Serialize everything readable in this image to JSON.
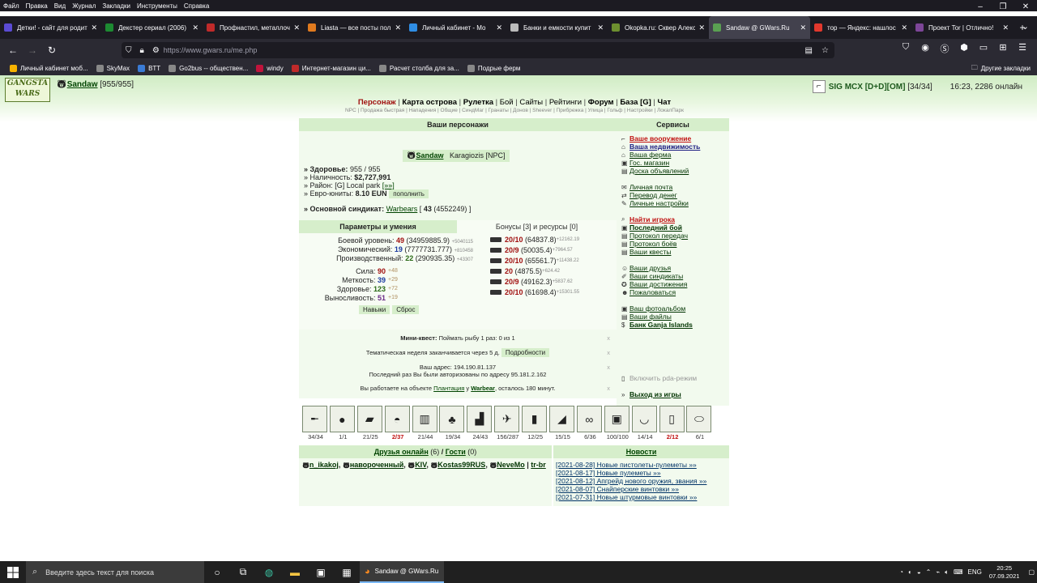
{
  "menubar": [
    "Файл",
    "Правка",
    "Вид",
    "Журнал",
    "Закладки",
    "Инструменты",
    "Справка"
  ],
  "tabs": [
    {
      "title": "Детки! - сайт для родит",
      "color": "#5b4bd4",
      "active": false
    },
    {
      "title": "Декстер сериал (2006)",
      "color": "#1d8a32",
      "active": false
    },
    {
      "title": "Профнастил, металлоч",
      "color": "#c02a2a",
      "active": false
    },
    {
      "title": "Liasta — все посты пол",
      "color": "#e07a1e",
      "active": false
    },
    {
      "title": "Личный кабинет - Мо",
      "color": "#2f8de4",
      "active": false
    },
    {
      "title": "Банки и емкости купит",
      "color": "#bbbbbb",
      "active": false
    },
    {
      "title": "Okopka.ru: Сквер Алекс",
      "color": "#6d8f2f",
      "active": false
    },
    {
      "title": "Sandaw @ GWars.Ru",
      "color": "#5aa052",
      "active": true
    },
    {
      "title": "тор — Яндекс: нашлос",
      "color": "#e2382d",
      "active": false
    },
    {
      "title": "Проект Tor | Отлично!",
      "color": "#7d4698",
      "active": false
    }
  ],
  "url": "https://www.gwars.ru/me.php",
  "bookmarks": [
    {
      "label": "Личный кабинет моб...",
      "color": "#f6b200"
    },
    {
      "label": "SkyMax",
      "color": "#888"
    },
    {
      "label": "BTT",
      "color": "#3a7bd5"
    },
    {
      "label": "Go2bus -- обществен...",
      "color": "#888"
    },
    {
      "label": "windy",
      "color": "#c0143c"
    },
    {
      "label": "Интернет-магазин ци...",
      "color": "#c02a2a"
    },
    {
      "label": "Расчет столба для за...",
      "color": "#888"
    },
    {
      "label": "Подрые ферм",
      "color": "#888"
    }
  ],
  "other_bookmarks": "Другие закладки",
  "logo_text": "GANGSTA WARS",
  "player": {
    "name": "Sandaw",
    "hp": "[955/955]"
  },
  "syndicate_top": {
    "name": "SIG MCX [D+D][OM]",
    "count": "[34/34]"
  },
  "time_online": "16:23, 2286 онлайн",
  "topnav": [
    "Персонаж",
    "Карта острова",
    "Рулетка",
    "Бой",
    "Сайты",
    "Рейтинги",
    "Форум",
    "База [G]",
    "Чат"
  ],
  "subnav": "NPC | Продажа быстрая | Нападения | Общие | СиндМаг | Гранаты | Донов | Sheever | Прибрежка | Улица | Гольф | Настройки | ЛокалПарк",
  "characters": {
    "header": "Ваши персонажи",
    "main_name": "Sandaw",
    "npc_name": "Karagiozis [NPC]",
    "health_label": "» Здоровье:",
    "health": "955 / 955",
    "cash_label": "» Наличность:",
    "cash": "$2,727,991",
    "district_label": "» Район:",
    "district": "[G] Local park",
    "district_link": "[»»]",
    "eun_label": "» Евро-юниты:",
    "eun": "8.10 EUN",
    "eun_btn": "пополнить",
    "synd_label": "» Основной синдикат:",
    "synd_name": "Warbears",
    "synd_lvl": "43",
    "synd_pts": "(4552249) ]"
  },
  "params": {
    "header": "Параметры и умения",
    "bonus_header": "Бонусы [3] и ресурсы [0]",
    "levels": [
      {
        "name": "Боевой уровень:",
        "lvl": "49",
        "exp": "(34959885.9)",
        "delta": "+5040115"
      },
      {
        "name": "Экономический:",
        "lvl": "19",
        "exp": "(7777731.777)",
        "delta": "+810458"
      },
      {
        "name": "Производственный:",
        "lvl": "22",
        "exp": "(290935.35)",
        "delta": "+43307"
      }
    ],
    "stats": [
      {
        "name": "Сила:",
        "val": "90",
        "bonus": "+48"
      },
      {
        "name": "Меткость:",
        "val": "39",
        "bonus": "+29"
      },
      {
        "name": "Здоровье:",
        "val": "123",
        "bonus": "+72"
      },
      {
        "name": "Выносливость:",
        "val": "51",
        "bonus": "+19"
      }
    ],
    "skills_btn": "Навыки",
    "reset_btn": "Сброс",
    "weapons": [
      {
        "lvl": "20/10",
        "exp": "(64837.8)",
        "delta": "+12162.19"
      },
      {
        "lvl": "20/9",
        "exp": "(50035.4)",
        "delta": "+7964.57"
      },
      {
        "lvl": "20/10",
        "exp": "(65561.7)",
        "delta": "+11438.22"
      },
      {
        "lvl": "20",
        "exp": "(4875.5)",
        "delta": "+624.42"
      },
      {
        "lvl": "20/9",
        "exp": "(49162.3)",
        "delta": "+5837.62"
      },
      {
        "lvl": "20/10",
        "exp": "(61698.4)",
        "delta": "+15301.55"
      }
    ]
  },
  "notes": {
    "quest_label": "Мини-квест:",
    "quest": "Поймать рыбу 1 раз: 0 из 1",
    "week": "Тематическая неделя заканчивается через 5 д.",
    "week_btn": "Подробности",
    "addr": "Ваш адрес: 194.190.81.137",
    "last_addr": "Последний раз Вы были авторизованы по адресу 95.181.2.162",
    "work_prefix": "Вы работаете на объекте",
    "work_obj": "Плантация",
    "work_mid": "у",
    "work_owner": "Warbear",
    "work_suffix": ", осталось 180 минут.",
    "close": "x"
  },
  "services": {
    "header": "Сервисы",
    "groups": [
      [
        "Ваше вооружение",
        "Ваша недвижимость",
        "Ваша ферма",
        "Гос. магазин",
        "Доска объявлений"
      ],
      [
        "Личная почта",
        "Перевод денег",
        "Личные настройки"
      ],
      [
        "Найти игрока",
        "Последний бой",
        "Протокол передач",
        "Протокол боёв",
        "Ваши квесты"
      ],
      [
        "Ваши друзья",
        "Ваши синдикаты",
        "Ваши достижения",
        "Пожаловаться"
      ],
      [
        "Ваш фотоальбом",
        "Ваши файлы",
        "Банк Ganja Islands"
      ]
    ],
    "pda": "Включить pda-режим",
    "exit": "Выход из игры"
  },
  "items": [
    {
      "icon": "rifle-icon",
      "count": "34/34",
      "red": false
    },
    {
      "icon": "mine-icon",
      "count": "1/1",
      "red": false
    },
    {
      "icon": "vest-icon",
      "count": "21/25",
      "red": false
    },
    {
      "icon": "helmet-icon",
      "count": "2/37",
      "red": true
    },
    {
      "icon": "armor-icon",
      "count": "21/44",
      "red": false
    },
    {
      "icon": "camo-icon",
      "count": "19/34",
      "red": false
    },
    {
      "icon": "boots-icon",
      "count": "24/43",
      "red": false
    },
    {
      "icon": "helicopter-icon",
      "count": "156/287",
      "red": false
    },
    {
      "icon": "phone-icon",
      "count": "12/25",
      "red": false
    },
    {
      "icon": "scanner-icon",
      "count": "15/15",
      "red": false
    },
    {
      "icon": "binoculars-icon",
      "count": "6/36",
      "red": false
    },
    {
      "icon": "badge-icon",
      "count": "100/100",
      "red": false
    },
    {
      "icon": "cup-icon",
      "count": "14/14",
      "red": false
    },
    {
      "icon": "bottle-icon",
      "count": "2/12",
      "red": true
    },
    {
      "icon": "dogtag-icon",
      "count": "6/1",
      "red": false
    }
  ],
  "friends": {
    "header": "Друзья онлайн",
    "count": "(6)",
    "guests": "Гости",
    "guests_count": "(0)",
    "list": [
      "n_ikakoj",
      "навороченный",
      "KIV",
      "Kostas99RUS",
      "NeveMo",
      "tr-br"
    ]
  },
  "news": {
    "header": "Новости",
    "items": [
      "[2021-08-28] Новые пистолеты-пулеметы »»",
      "[2021-08-17] Новые пулеметы »»",
      "[2021-08-12] Апгрейд нового оружия, звания »»",
      "[2021-08-07] Снайперские винтовки »»",
      "[2021-07-31] Новые штурмовые винтовки »»"
    ]
  },
  "taskbar": {
    "search": "Введите здесь текст для поиска",
    "active_app": "Sandaw @ GWars.Ru",
    "lang": "ENG",
    "time": "20:25",
    "date": "07.09.2021"
  }
}
